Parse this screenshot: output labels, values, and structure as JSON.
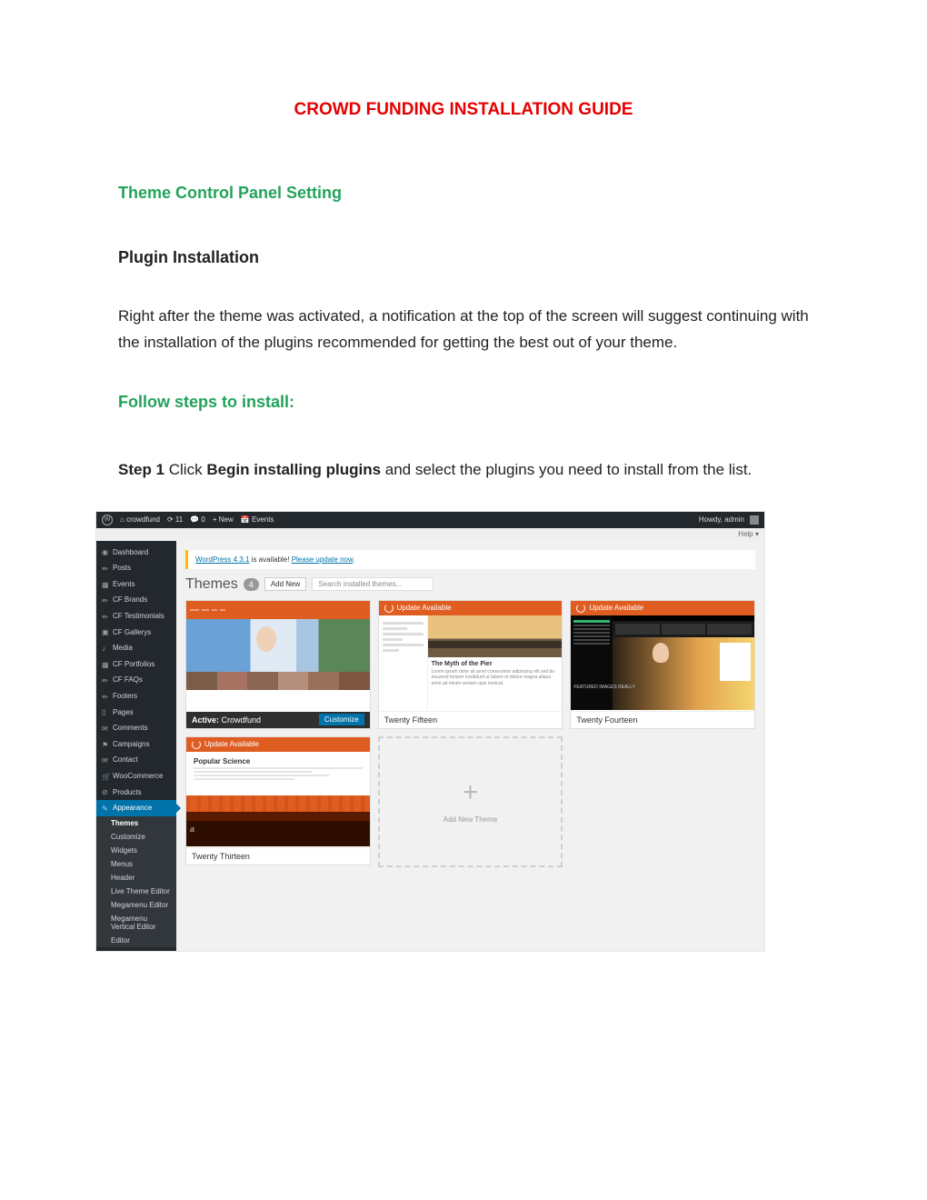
{
  "doc": {
    "title": "CROWD FUNDING INSTALLATION GUIDE",
    "section1": "Theme Control Panel Setting",
    "section2": "Plugin Installation",
    "paragraph1": "Right after the theme was activated, a notification at the top of the screen will suggest continuing with the installation of the plugins recommended for getting the best out of your theme.",
    "section3": "Follow steps to install:",
    "step1_prefix": "Step 1",
    "step1_mid": " Click ",
    "step1_action": "Begin installing plugins",
    "step1_suffix": " and select the plugins you need to install from the list."
  },
  "wp": {
    "adminbar": {
      "site": "crowdfund",
      "updates": "11",
      "comments": "0",
      "new": "+ New",
      "events": "Events",
      "howdy": "Howdy, admin"
    },
    "help": "Help ▾",
    "notice": {
      "a": "WordPress 4.3.1",
      "b": " is available! ",
      "c": "Please update now"
    },
    "titlebar": {
      "title": "Themes",
      "count": "4",
      "addnew": "Add New",
      "search": "Search installed themes..."
    },
    "sidebar": [
      {
        "icon": "dash",
        "label": "Dashboard"
      },
      {
        "icon": "pin",
        "label": "Posts"
      },
      {
        "icon": "cal",
        "label": "Events"
      },
      {
        "icon": "pin",
        "label": "CF Brands"
      },
      {
        "icon": "pin",
        "label": "CF Testimonials"
      },
      {
        "icon": "pic",
        "label": "CF Gallerys"
      },
      {
        "icon": "media",
        "label": "Media"
      },
      {
        "icon": "grid",
        "label": "CF Portfolios"
      },
      {
        "icon": "pin",
        "label": "CF FAQs"
      },
      {
        "icon": "pin",
        "label": "Footers"
      },
      {
        "icon": "page",
        "label": "Pages"
      },
      {
        "icon": "comment",
        "label": "Comments"
      },
      {
        "icon": "flag",
        "label": "Campaigns"
      },
      {
        "icon": "mail",
        "label": "Contact"
      },
      {
        "icon": "cart",
        "label": "WooCommerce"
      },
      {
        "icon": "tag",
        "label": "Products"
      },
      {
        "icon": "brush",
        "label": "Appearance",
        "active": true
      }
    ],
    "appearance_sub": [
      "Themes",
      "Customize",
      "Widgets",
      "Menus",
      "Header",
      "Live Theme Editor",
      "Megamenu Editor",
      "Megamenu Vertical Editor",
      "Editor"
    ],
    "themes": {
      "update_label": "Update Available",
      "active_prefix": "Active:",
      "active_name": "Crowdfund",
      "customize": "Customize",
      "t2015": {
        "name": "Twenty Fifteen",
        "post_title": "The Myth of the Pier"
      },
      "t2014": {
        "name": "Twenty Fourteen",
        "caption": "FEATURED IMAGES REALLY"
      },
      "t2013": {
        "name": "Twenty Thirteen",
        "hdr": "Popular Science"
      },
      "addnew": "Add New Theme"
    }
  }
}
